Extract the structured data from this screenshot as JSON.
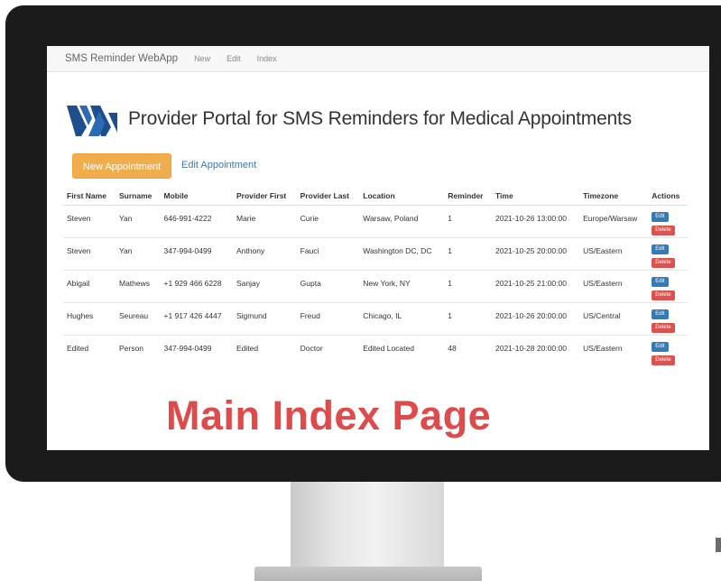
{
  "navbar": {
    "brand": "SMS Reminder WebApp",
    "links": [
      "New",
      "Edit",
      "Index"
    ]
  },
  "header": {
    "title": "Provider Portal for SMS Reminders for Medical Appointments",
    "logo": "va-logo"
  },
  "buttons": {
    "new_appointment": "New Appointment",
    "edit_appointment": "Edit Appointment"
  },
  "table": {
    "headers": [
      "First Name",
      "Surname",
      "Mobile",
      "Provider First",
      "Provider Last",
      "Location",
      "Reminder",
      "Time",
      "Timezone",
      "Actions"
    ],
    "rows": [
      [
        "Steven",
        "Yan",
        "646-991-4222",
        "Marie",
        "Curie",
        "Warsaw, Poland",
        "1",
        "2021-10-26 13:00:00",
        "Europe/Warsaw"
      ],
      [
        "Steven",
        "Yan",
        "347-994-0499",
        "Anthony",
        "Fauci",
        "Washington DC, DC",
        "1",
        "2021-10-25 20:00:00",
        "US/Eastern"
      ],
      [
        "Abigail",
        "Mathews",
        "+1 929 466 6228",
        "Sanjay",
        "Gupta",
        "New York, NY",
        "1",
        "2021-10-25 21:00:00",
        "US/Eastern"
      ],
      [
        "Hughes",
        "Seureau",
        "+1 917 426 4447",
        "Sigmund",
        "Freud",
        "Chicago, IL",
        "1",
        "2021-10-26 20:00:00",
        "US/Central"
      ],
      [
        "Edited",
        "Person",
        "347-994-0499",
        "Edited",
        "Doctor",
        "Edited Located",
        "48",
        "2021-10-28 20:00:00",
        "US/Eastern"
      ]
    ],
    "edit_label": "Edit",
    "delete_label": "Delete"
  },
  "caption": "Main Index Page",
  "colors": {
    "primary": "#337ab7",
    "warning": "#f0ad4e",
    "danger": "#d9534f",
    "caption": "#dd4b4b",
    "logo_blue": "#1f4e8c"
  }
}
